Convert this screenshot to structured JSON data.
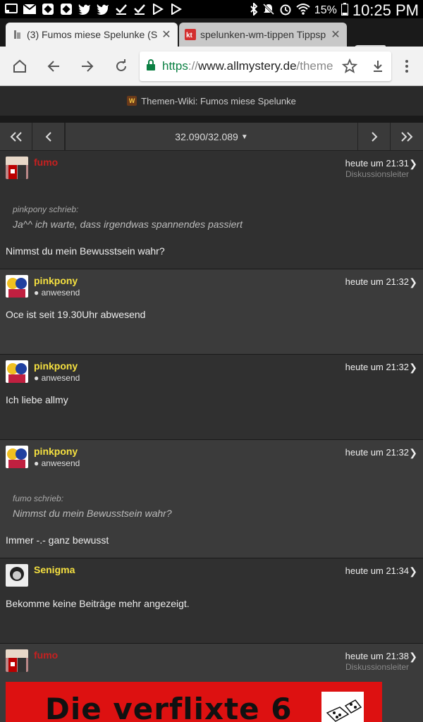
{
  "status_bar": {
    "battery": "15%",
    "time": "10:25 PM"
  },
  "tabs": [
    {
      "title": "(3) Fumos miese Spelunke (S",
      "favicon": "allmystery-favicon",
      "active": true
    },
    {
      "title": "spelunken-wm-tippen Tippsp",
      "favicon": "kt",
      "active": false
    }
  ],
  "url": {
    "scheme": "https",
    "sep": "://",
    "host": "www.allmystery.de",
    "path": "/theme"
  },
  "page_header": {
    "logo": "W",
    "title": "Themen-Wiki: Fumos miese Spelunke"
  },
  "pager": {
    "label": "32.090/32.089"
  },
  "posts": [
    {
      "user": "fumo",
      "time": "heute um 21:31",
      "role": "Diskussionsleiter",
      "quote_author": "pinkpony schrieb:",
      "quote_text": "Ja^^ ich warte, dass irgendwas spannendes passiert",
      "text": "Nimmst du mein Bewusstsein wahr?"
    },
    {
      "user": "pinkpony",
      "status": "● anwesend",
      "time": "heute um 21:32",
      "text": "Oce ist seit 19.30Uhr abwesend"
    },
    {
      "user": "pinkpony",
      "status": "● anwesend",
      "time": "heute um 21:32",
      "text": "Ich liebe allmy"
    },
    {
      "user": "pinkpony",
      "status": "● anwesend",
      "time": "heute um 21:32",
      "quote_author": "fumo schrieb:",
      "quote_text": "Nimmst du mein Bewusstsein wahr?",
      "text": "Immer -.- ganz bewusst"
    },
    {
      "user": "Senigma",
      "time": "heute um 21:34",
      "text": "Bekomme keine Beiträge mehr angezeigt."
    },
    {
      "user": "fumo",
      "time": "heute um 21:38",
      "role": "Diskussionsleiter",
      "banner_text": "Die verflixte 6"
    }
  ],
  "colors": {
    "mod_name": "#c62020",
    "user_name": "#f5e040",
    "secure_url": "#0b8043"
  }
}
